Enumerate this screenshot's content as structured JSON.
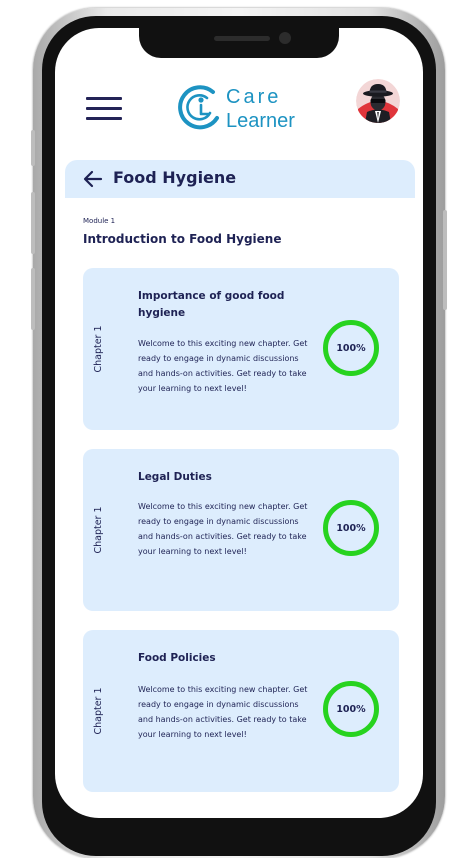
{
  "app": {
    "logo_line1": "Care",
    "logo_line2": "Learner",
    "brand_color": "#1d93c2"
  },
  "icons": {
    "menu": "hamburger-menu-icon",
    "back": "arrow-left-icon",
    "avatar": "spy-avatar"
  },
  "page": {
    "title": "Food Hygiene"
  },
  "module": {
    "label": "Module 1",
    "title": "Introduction to Food Hygiene"
  },
  "chapters": [
    {
      "chapter_label": "Chapter 1",
      "title": "Importance of good food hygiene",
      "description": "Welcome to this exciting new chapter. Get ready to engage in dynamic discussions and hands-on activities. Get ready to take your learning to next level!",
      "progress_label": "100%",
      "progress_color": "#27d31f"
    },
    {
      "chapter_label": "Chapter 1",
      "title": "Legal Duties",
      "description": "Welcome to this exciting new chapter. Get ready to engage in dynamic discussions and hands-on activities. Get ready to take your learning to next level!",
      "progress_label": "100%",
      "progress_color": "#27d31f"
    },
    {
      "chapter_label": "Chapter 1",
      "title": "Food Policies",
      "description": "Welcome to this exciting new chapter. Get ready to engage in dynamic discussions and hands-on activities. Get ready to take your learning to next level!",
      "progress_label": "100%",
      "progress_color": "#27d31f"
    }
  ]
}
